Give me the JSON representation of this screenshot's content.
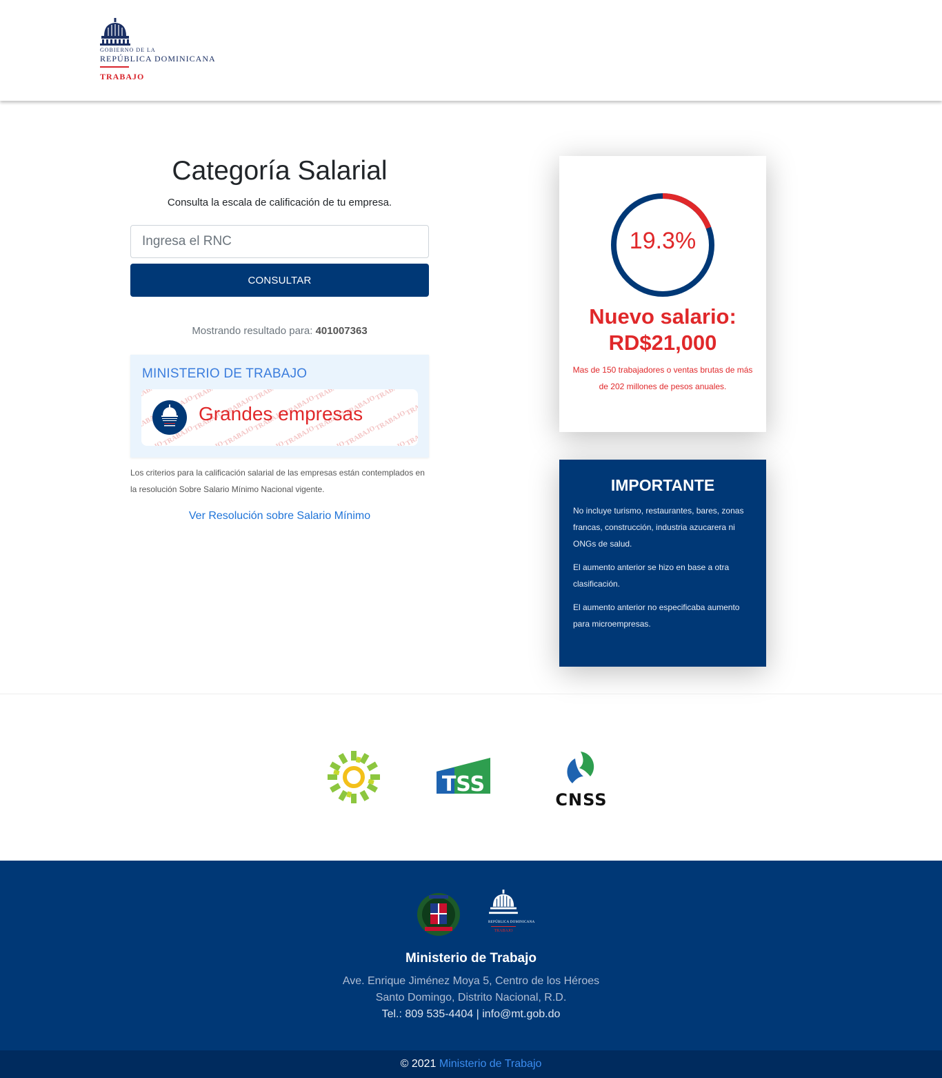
{
  "header": {
    "logo_line1": "GOBIERNO DE LA",
    "logo_line2": "REPÚBLICA DOMINICANA",
    "logo_line3": "TRABAJO"
  },
  "main": {
    "title": "Categoría Salarial",
    "subtitle": "Consulta la escala de calificación de tu empresa.",
    "rnc_placeholder": "Ingresa el RNC",
    "rnc_value": "",
    "submit_label": "CONSULTAR",
    "result_prefix": "Mostrando resultado para:",
    "result_rnc": "401007363",
    "result_org": "MINISTERIO DE TRABAJO",
    "category": "Grandes empresas",
    "watermark": "TRABAJO",
    "criteria": "Los criterios para la calificación salarial de las empresas están contemplados en la resolución Sobre Salario Mínimo Nacional vigente.",
    "resolution_link": "Ver Resolución sobre Salario Mínimo"
  },
  "salary_card": {
    "percent_label": "19.3%",
    "percent_value": 19.3,
    "new_salary_label": "Nuevo salario:",
    "new_salary_amount": "RD$21,000",
    "description": "Mas de 150 trabajadores o ventas brutas de más de 202 millones de pesos anuales."
  },
  "important": {
    "title": "IMPORTANTE",
    "paragraphs": [
      "No incluye turismo, restaurantes, bares, zonas francas, construcción, industria azucarera ni ONGs de salud.",
      "El aumento anterior se hizo en base a otra clasificación.",
      "El aumento anterior no especificaba aumento para microempresas."
    ]
  },
  "partners": {
    "tss": "TSS",
    "cnss": "CNSS"
  },
  "footer": {
    "seal_logo_line2": "REPÚBLICA DOMINICANA",
    "seal_logo_line3": "TRABAJO",
    "title": "Ministerio de Trabajo",
    "address1": "Ave. Enrique Jiménez Moya 5, Centro de los Héroes",
    "address2": "Santo Domingo, Distrito Nacional, R.D.",
    "contact": "Tel.: 809 535-4404 | info@mt.gob.do",
    "copyright": "© 2021",
    "copyright_link": "Ministerio de Trabajo"
  },
  "colors": {
    "primary": "#003876",
    "accent_red": "#e0282a",
    "link_blue": "#1e73d8"
  }
}
